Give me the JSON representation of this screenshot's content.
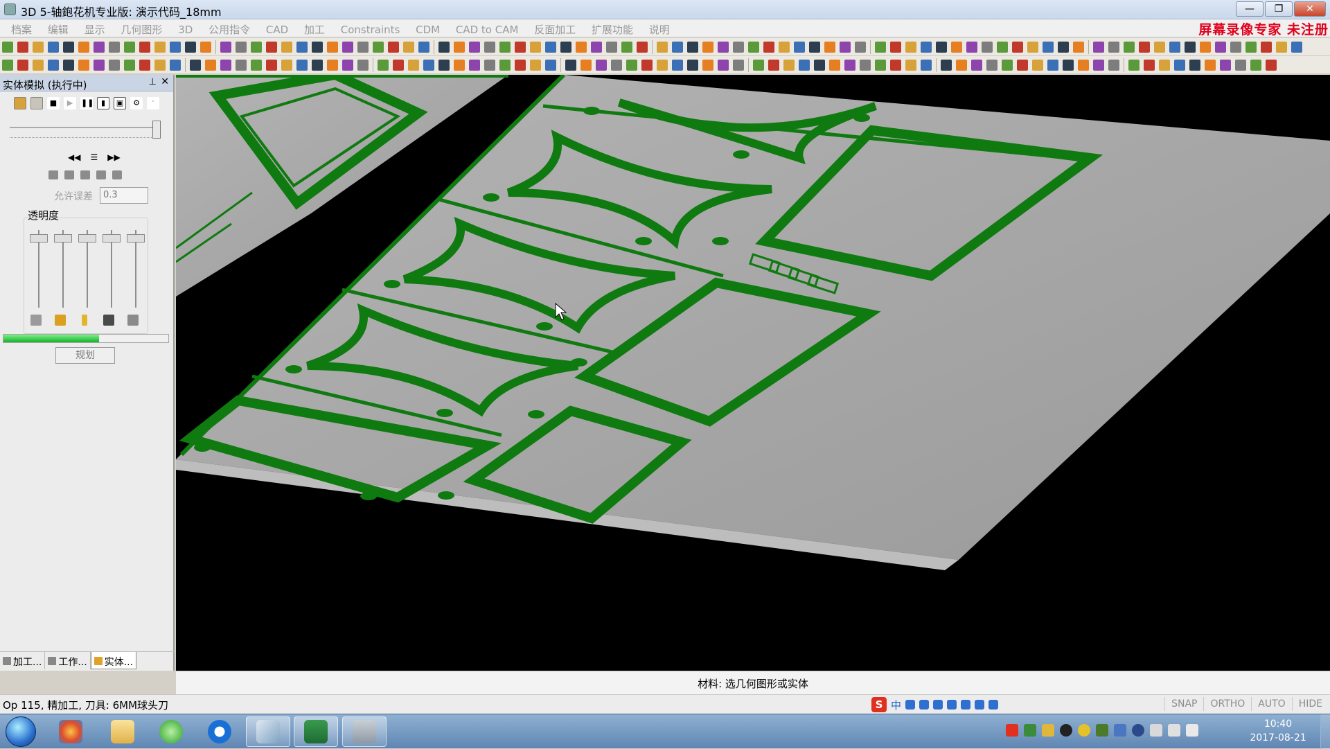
{
  "window": {
    "title": "3D 5-轴鉋花机专业版: 演示代码_18mm",
    "buttons": {
      "minimize": "—",
      "restore": "❐",
      "close": "✕"
    },
    "watermark": "屏幕录像专家  未注册"
  },
  "menu": [
    "档案",
    "编辑",
    "显示",
    "几何图形",
    "3D",
    "公用指令",
    "CAD",
    "加工",
    "Constraints",
    "CDM",
    "CAD to CAM",
    "反面加工",
    "扩展功能",
    "说明"
  ],
  "panel": {
    "title": "实体模拟 (执行中)",
    "pin_icon": "pin-icon",
    "tolerance_label": "允许误差",
    "tolerance_value": "0.3",
    "transparency_label": "透明度",
    "progress_fraction": 0.58,
    "plan_button": "规划",
    "tabs": [
      "加工...",
      "工作...",
      "实体..."
    ]
  },
  "viewport": {
    "background": "#000000",
    "stock_color": "#a3a3a3",
    "cut_color": "#0f7a0f"
  },
  "message": "材料: 选几何图形或实体",
  "status": {
    "operation": "Op 115, 精加工, 刀具: 6MM球头刀",
    "ime_chinese": "中",
    "snap_buttons": [
      "SNAP",
      "ORTHO",
      "AUTO",
      "HIDE"
    ]
  },
  "taskbar": {
    "apps": [
      "start-orb",
      "media-app",
      "file-explorer",
      "browser",
      "teamviewer",
      "writing-app",
      "excel",
      "cad-app"
    ],
    "time": "10:40",
    "date": "2017-08-21"
  },
  "colors": {
    "title_gradient_top": "#dce6f4",
    "accent_red": "#e0001b",
    "green_cut": "#0f7a0f"
  }
}
